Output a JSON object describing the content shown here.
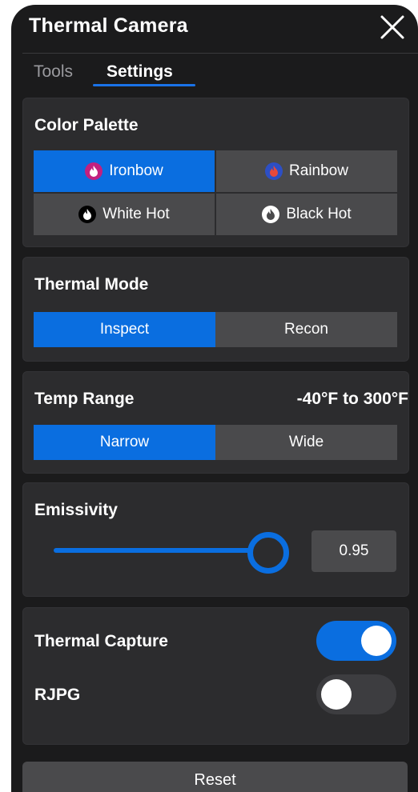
{
  "header": {
    "title": "Thermal Camera",
    "close_icon": "close-icon"
  },
  "tabs": [
    {
      "label": "Tools",
      "active": false
    },
    {
      "label": "Settings",
      "active": true
    }
  ],
  "color_palette": {
    "label": "Color Palette",
    "options": [
      {
        "label": "Ironbow",
        "selected": true,
        "icon": "flame-icon",
        "icon_bg": "#c2207f",
        "icon_fg": "#ffffff"
      },
      {
        "label": "Rainbow",
        "selected": false,
        "icon": "flame-icon",
        "icon_bg": "#2d4fc4",
        "icon_fg": "#e8493a"
      },
      {
        "label": "White Hot",
        "selected": false,
        "icon": "flame-icon",
        "icon_bg": "#000000",
        "icon_fg": "#ffffff"
      },
      {
        "label": "Black Hot",
        "selected": false,
        "icon": "flame-icon",
        "icon_bg": "#ffffff",
        "icon_fg": "#4a4a4c"
      }
    ]
  },
  "thermal_mode": {
    "label": "Thermal Mode",
    "options": [
      {
        "label": "Inspect",
        "selected": true
      },
      {
        "label": "Recon",
        "selected": false
      }
    ]
  },
  "temp_range": {
    "label": "Temp Range",
    "value": "-40°F to 300°F",
    "options": [
      {
        "label": "Narrow",
        "selected": true
      },
      {
        "label": "Wide",
        "selected": false
      }
    ]
  },
  "emissivity": {
    "label": "Emissivity",
    "value": "0.95"
  },
  "toggles": {
    "thermal_capture": {
      "label": "Thermal Capture",
      "on": true
    },
    "rjpg": {
      "label": "RJPG",
      "on": false
    }
  },
  "reset_label": "Reset",
  "colors": {
    "accent": "#0a6ee0",
    "panel_bg": "#1b1b1c",
    "section_bg": "#2c2c2e",
    "button_bg": "#4a4a4c"
  }
}
